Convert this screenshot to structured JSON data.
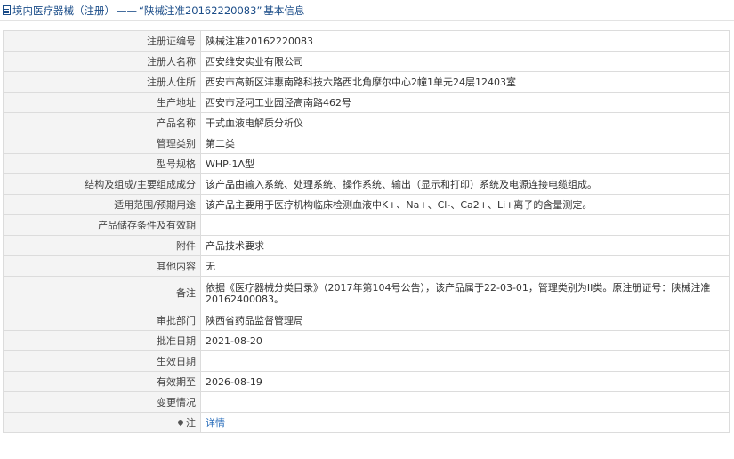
{
  "header": {
    "category": "境内医疗器械（注册）",
    "dash": "——",
    "reg_quote": "“陕械注准20162220083”",
    "section": "基本信息"
  },
  "rows": [
    {
      "label": "注册证编号",
      "value": "陕械注准20162220083"
    },
    {
      "label": "注册人名称",
      "value": "西安维安实业有限公司"
    },
    {
      "label": "注册人住所",
      "value": "西安市高新区沣惠南路科技六路西北角摩尔中心2幢1单元24层12403室"
    },
    {
      "label": "生产地址",
      "value": "西安市泾河工业园泾高南路462号"
    },
    {
      "label": "产品名称",
      "value": "干式血液电解质分析仪"
    },
    {
      "label": "管理类别",
      "value": "第二类"
    },
    {
      "label": "型号规格",
      "value": "WHP-1A型"
    },
    {
      "label": "结构及组成/主要组成成分",
      "value": "该产品由输入系统、处理系统、操作系统、输出（显示和打印）系统及电源连接电缆组成。"
    },
    {
      "label": "适用范围/预期用途",
      "value": "该产品主要用于医疗机构临床检测血液中K+、Na+、Cl-、Ca2+、Li+离子的含量测定。"
    },
    {
      "label": "产品储存条件及有效期",
      "value": ""
    },
    {
      "label": "附件",
      "value": "产品技术要求"
    },
    {
      "label": "其他内容",
      "value": "无"
    },
    {
      "label": "备注",
      "value": "依据《医疗器械分类目录》（2017年第104号公告），该产品属于22-03-01，管理类别为II类。原注册证号：陕械注准20162400083。"
    },
    {
      "label": "审批部门",
      "value": "陕西省药品监督管理局"
    },
    {
      "label": "批准日期",
      "value": "2021-08-20"
    },
    {
      "label": "生效日期",
      "value": ""
    },
    {
      "label": "有效期至",
      "value": "2026-08-19"
    },
    {
      "label": "变更情况",
      "value": ""
    }
  ],
  "note_row": {
    "label": "注",
    "link": "详情",
    "icon": "pin-icon"
  }
}
